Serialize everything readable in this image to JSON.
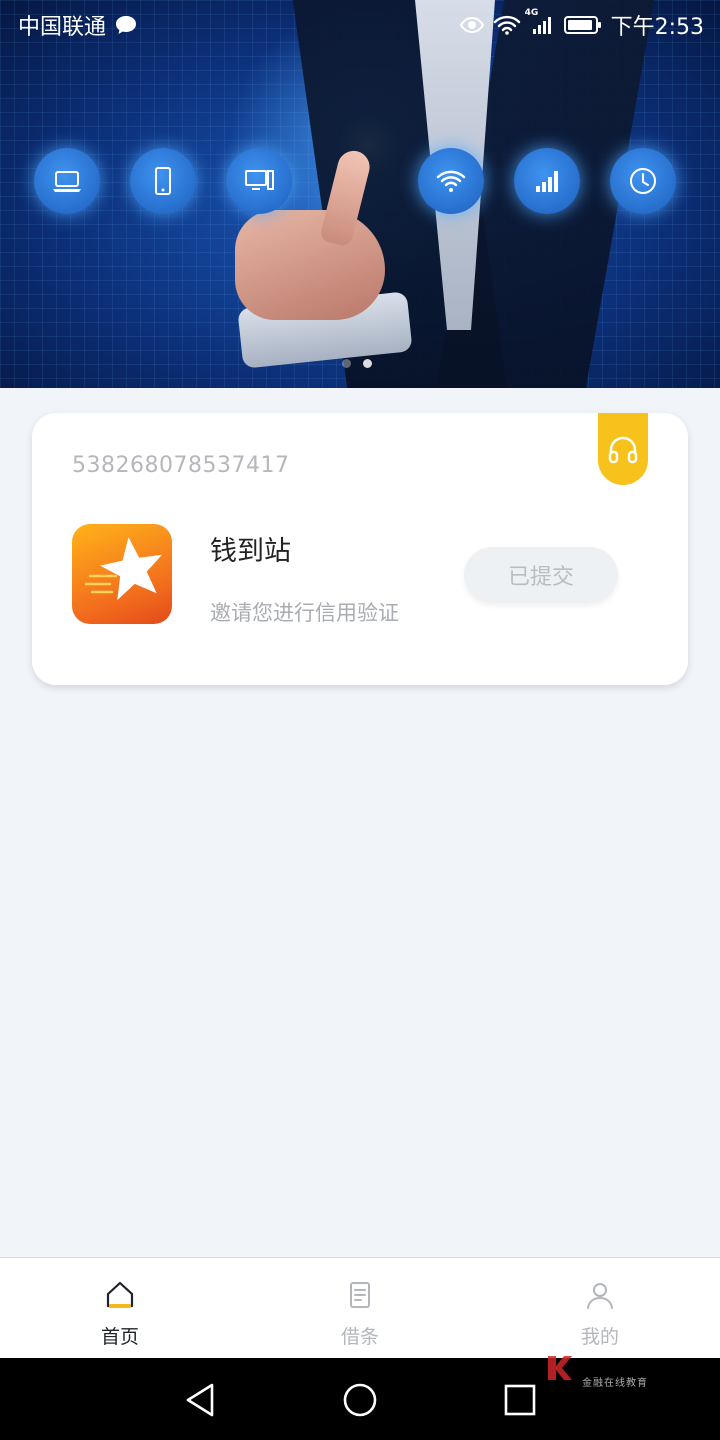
{
  "status_bar": {
    "carrier": "中国联通",
    "network": "4G",
    "time": "下午2:53"
  },
  "banner": {
    "icons": [
      "laptop-icon",
      "phone-icon",
      "desktop-icon",
      "wifi-icon",
      "signal-icon",
      "clock-icon"
    ],
    "page_count": 2,
    "active_page": 2
  },
  "card": {
    "id_number": "538268078537417",
    "app_name": "钱到站",
    "app_description": "邀请您进行信用验证",
    "status_button": "已提交",
    "service_icon": "headset-icon",
    "accent_color": "#f7c21b"
  },
  "tabbar": {
    "tabs": [
      {
        "label": "首页",
        "icon": "home-icon",
        "active": true
      },
      {
        "label": "借条",
        "icon": "document-icon",
        "active": false
      },
      {
        "label": "我的",
        "icon": "user-icon",
        "active": false
      }
    ]
  },
  "navbar": {
    "buttons": [
      "back-icon",
      "home-circle-icon",
      "recents-icon"
    ]
  },
  "watermark": {
    "text": "金融在线教育"
  }
}
